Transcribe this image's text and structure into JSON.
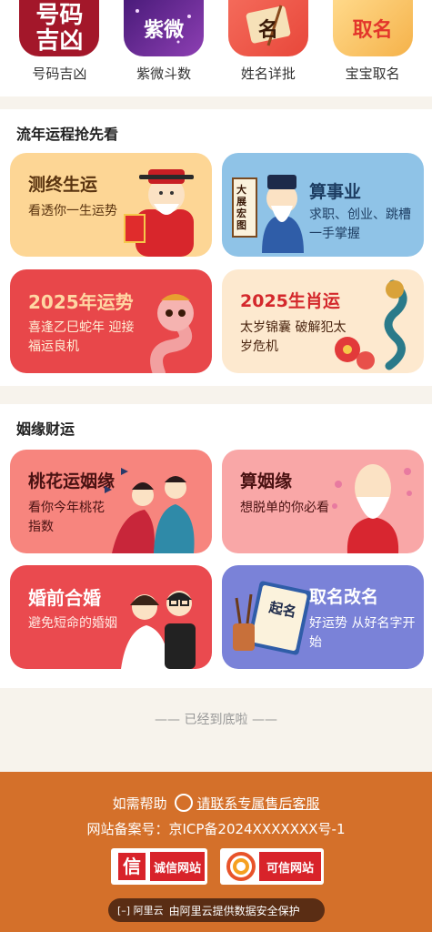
{
  "top_icons": [
    {
      "label": "号码吉凶",
      "art": "号码\n吉凶"
    },
    {
      "label": "紫微斗数",
      "art": "紫微"
    },
    {
      "label": "姓名详批",
      "art": "名"
    },
    {
      "label": "宝宝取名",
      "art": "取名"
    }
  ],
  "section1": {
    "title": "流年运程抢先看",
    "cards": [
      {
        "title": "测终生运",
        "subtitle": "看透你一生运势"
      },
      {
        "title": "算事业",
        "subtitle": "求职、创业、跳槽一手掌握",
        "scroll_text": "大展宏图"
      },
      {
        "title": "2025年运势",
        "subtitle": "喜逢乙巳蛇年 迎接福运良机"
      },
      {
        "title": "2025生肖运",
        "subtitle": "太岁锦囊 破解犯太岁危机"
      }
    ]
  },
  "section2": {
    "title": "姻缘财运",
    "cards": [
      {
        "title": "桃花运姻缘",
        "subtitle": "看你今年桃花指数"
      },
      {
        "title": "算姻缘",
        "subtitle": "想脱单的你必看"
      },
      {
        "title": "婚前合婚",
        "subtitle": "避免短命的婚姻"
      },
      {
        "title": "取名改名",
        "subtitle": "好运势 从好名字开始",
        "book_text": "起名"
      }
    ]
  },
  "end_text": "—— 已经到底啦 ——",
  "footer": {
    "help_prefix": "如需帮助",
    "help_link": "请联系专属售后客服",
    "icp": "网站备案号：京ICP备2024XXXXXXX号-1",
    "badge1_logo": "信",
    "badge1_text": "诚信网站",
    "badge2_text": "可信网站",
    "aliyun_logo": "阿里云",
    "aliyun_text": "由阿里云提供数据安全保护"
  }
}
